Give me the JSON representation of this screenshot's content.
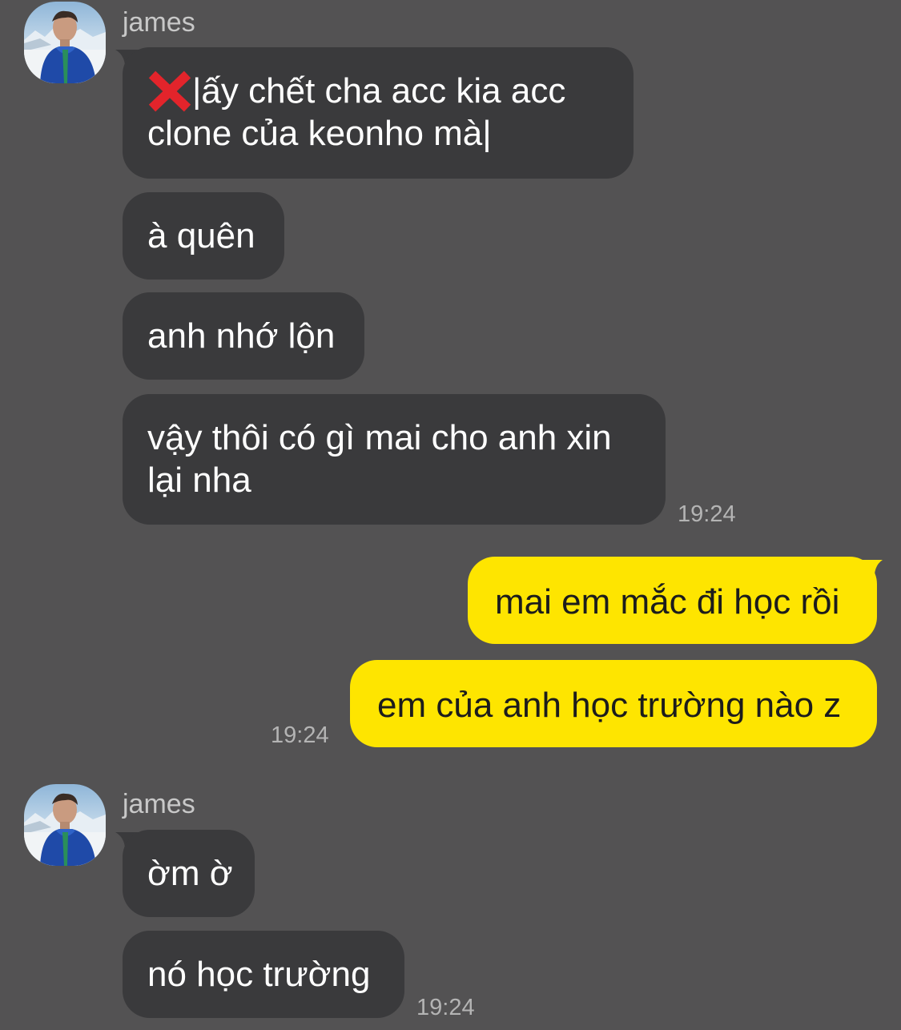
{
  "messages": {
    "group1": {
      "sender": "james",
      "m1_line1": "|ấy chết cha acc kia acc",
      "m1_line2": "clone của keonho mà|",
      "m2": "à quên",
      "m3": "anh nhớ lộn",
      "m4_line1": "vậy thôi có gì mai cho anh xin",
      "m4_line2": "lại nha",
      "time": "19:24"
    },
    "mine": {
      "m1": "mai em mắc đi học rồi",
      "m2": "em của anh học trường nào z",
      "time": "19:24"
    },
    "group2": {
      "sender": "james",
      "m1": "ờm ờ",
      "m2": "nó học trường",
      "time": "19:24"
    }
  },
  "colors": {
    "background": "#535253",
    "incoming_bubble": "#3a3a3c",
    "outgoing_bubble": "#fee500"
  }
}
